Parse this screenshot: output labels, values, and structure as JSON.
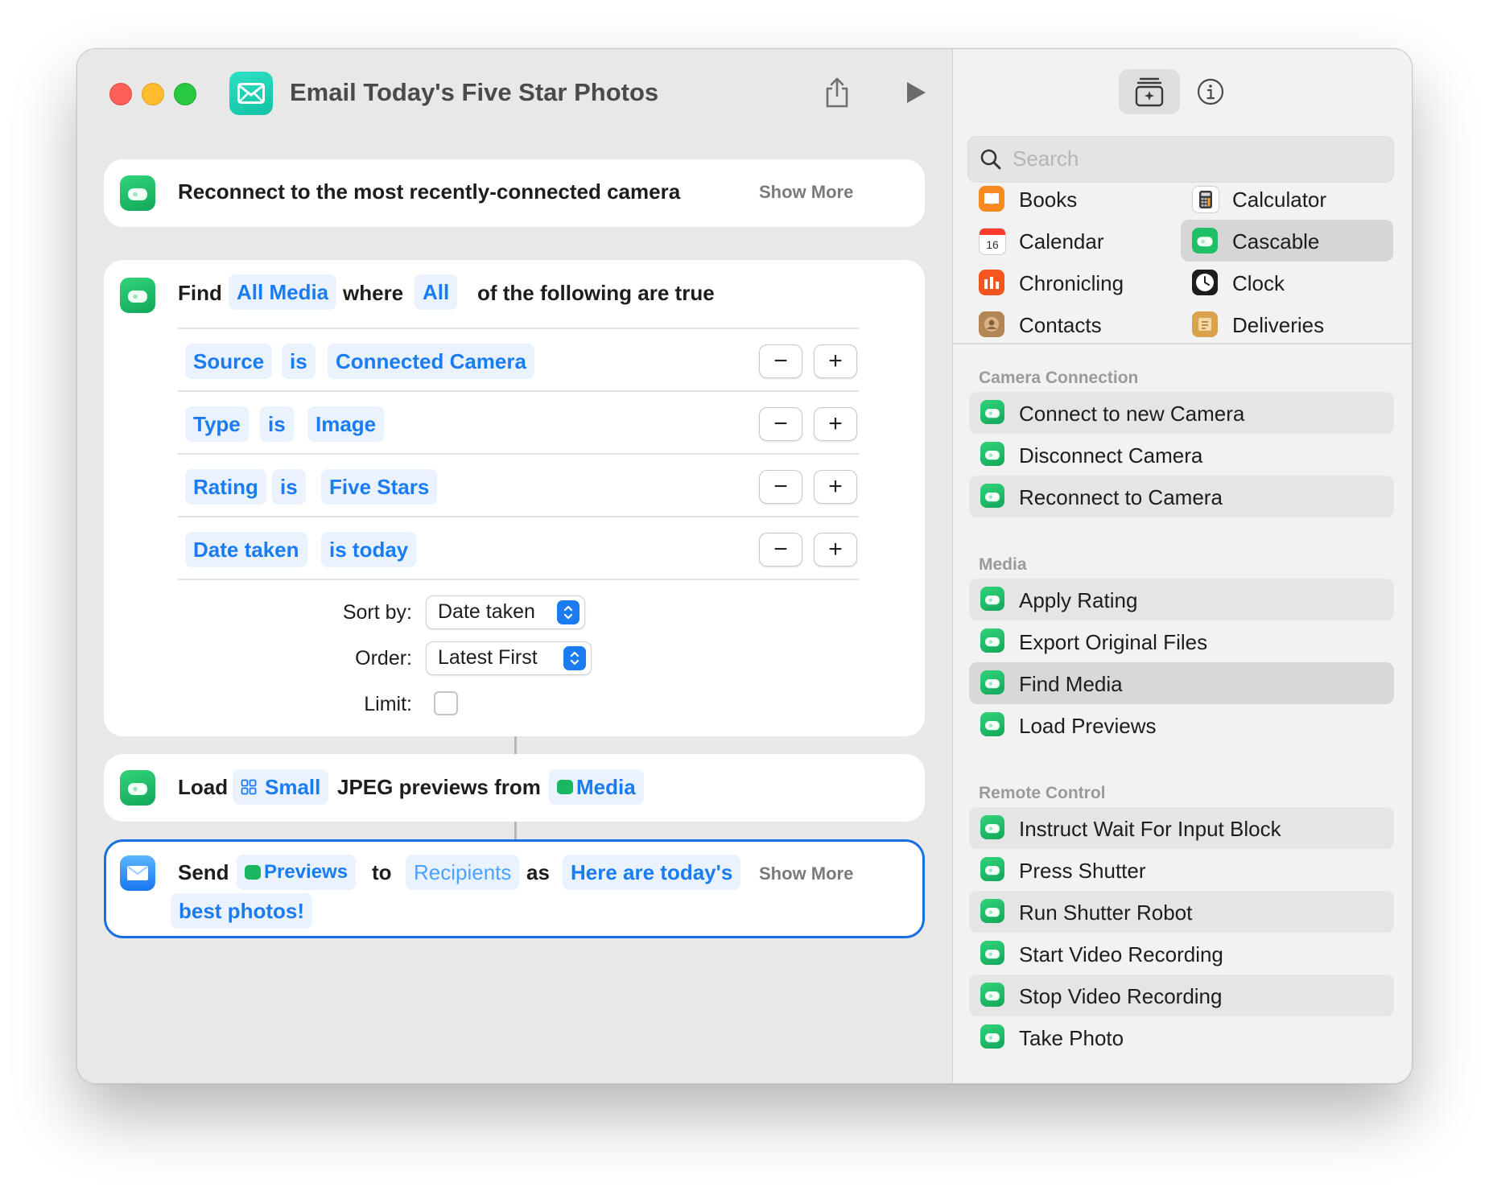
{
  "window": {
    "title": "Email Today's Five Star Photos"
  },
  "actions": {
    "reconnect": {
      "label": "Reconnect to the most recently-connected camera",
      "show_more": "Show More"
    },
    "find": {
      "word_find": "Find",
      "media_token": "All Media",
      "word_where": "where",
      "all_token": "All",
      "tail": "of the following are true",
      "conditions": [
        {
          "field": "Source",
          "op": "is",
          "value": "Connected Camera"
        },
        {
          "field": "Type",
          "op": "is",
          "value": "Image"
        },
        {
          "field": "Rating",
          "op": "is",
          "value": "Five Stars"
        },
        {
          "field": "Date taken",
          "op": "is today",
          "value": ""
        }
      ],
      "minus": "−",
      "plus": "+",
      "sort_label": "Sort by:",
      "sort_value": "Date taken",
      "order_label": "Order:",
      "order_value": "Latest First",
      "limit_label": "Limit:"
    },
    "load": {
      "word_load": "Load",
      "size_token": "Small",
      "middle": "JPEG previews from",
      "media_token": "Media"
    },
    "send": {
      "word_send": "Send",
      "previews_token": "Previews",
      "word_to": "to",
      "recipients_token": "Recipients",
      "word_as": "as",
      "message_line1": "Here are today's",
      "message_line2": "best photos!",
      "show_more": "Show More"
    }
  },
  "sidebar": {
    "search_placeholder": "Search",
    "apps": [
      {
        "label": "Books",
        "icon": "books-icon",
        "color": "#f68a1f"
      },
      {
        "label": "Calculator",
        "icon": "calculator-icon",
        "color": "#3a3a3a"
      },
      {
        "label": "Calendar",
        "icon": "calendar-icon",
        "color": "#ffffff"
      },
      {
        "label": "Cascable",
        "icon": "cascable-icon",
        "color": "#1fbf67"
      },
      {
        "label": "Chronicling",
        "icon": "chronicling-icon",
        "color": "#f5561f"
      },
      {
        "label": "Clock",
        "icon": "clock-icon",
        "color": "#1d1d1f"
      },
      {
        "label": "Contacts",
        "icon": "contacts-icon",
        "color": "#b48555"
      },
      {
        "label": "Deliveries",
        "icon": "deliveries-icon",
        "color": "#d9a24c"
      }
    ],
    "calendar_day": "16",
    "sections": [
      {
        "title": "Camera Connection",
        "items": [
          "Connect to new Camera",
          "Disconnect Camera",
          "Reconnect to Camera"
        ]
      },
      {
        "title": "Media",
        "items": [
          "Apply Rating",
          "Export Original Files",
          "Find Media",
          "Load Previews"
        ]
      },
      {
        "title": "Remote Control",
        "items": [
          "Instruct Wait For Input Block",
          "Press Shutter",
          "Run Shutter Robot",
          "Start Video Recording",
          "Stop Video Recording",
          "Take Photo"
        ]
      }
    ]
  }
}
